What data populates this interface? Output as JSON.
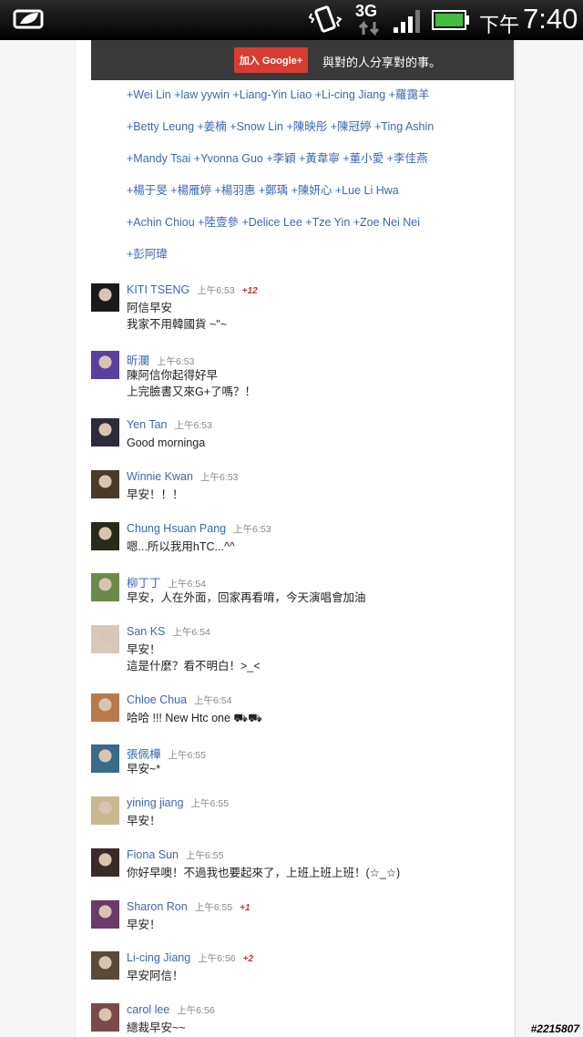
{
  "status_bar": {
    "network": "3G",
    "time_prefix": "下午",
    "time": "7:40"
  },
  "gplus_banner": {
    "button_label": "加入 Google+",
    "tagline": "與對的人分享對的事。"
  },
  "mentions": [
    "+Wei Lin +law yywin +Liang-Yin Liao +Li-cing Jiang +羅靄羊",
    "+Betty Leung +姜楠 +Snow Lin +陳映彤 +陳冠婷 +Ting Ashin",
    "+Mandy Tsai +Yvonna Guo +李穎 +黃韋寧 +董小愛 +李佳燕",
    "+楊于旻 +楊雁婷 +楊羽惠 +鄭瑀 +陳妍心 +Lue Li Hwa",
    "+Achin Chiou +陸壹參 +Delice Lee +Tze Yin +Zoe Nei Nei",
    "+彭阿瑋"
  ],
  "comments": [
    {
      "name": "KITI TSENG",
      "time": "上午6:53",
      "plus": "+12",
      "lines": [
        "阿信早安",
        "我家不用韓國貨 ~\"~"
      ],
      "avatar_color": "#1a1a1a"
    },
    {
      "name": "昕瀾",
      "time": "上午6:53",
      "plus": "",
      "lines": [
        "陳阿信你起得好早",
        "上完臉書又來G+了嗎？！"
      ],
      "avatar_color": "#5a3fa0"
    },
    {
      "name": "Yen Tan",
      "time": "上午6:53",
      "plus": "",
      "lines": [
        "Good morninga"
      ],
      "avatar_color": "#2b2b3a"
    },
    {
      "name": "Winnie Kwan",
      "time": "上午6:53",
      "plus": "",
      "lines": [
        "早安！！！"
      ],
      "avatar_color": "#4a3a2a"
    },
    {
      "name": "Chung Hsuan Pang",
      "time": "上午6:53",
      "plus": "",
      "lines": [
        "嗯...所以我用hTC...^^"
      ],
      "avatar_color": "#2a2a1a"
    },
    {
      "name": "柳丁丁",
      "time": "上午6:54",
      "plus": "",
      "lines": [
        "早安，人在外面，回家再看唷，今天演唱會加油"
      ],
      "avatar_color": "#6a8a4a"
    },
    {
      "name": "San KS",
      "time": "上午6:54",
      "plus": "",
      "lines": [
        "早安！",
        "這是什麼？看不明白！>_<"
      ],
      "avatar_color": "#d8c8b8"
    },
    {
      "name": "Chloe Chua",
      "time": "上午6:54",
      "plus": "",
      "lines": [
        "哈哈 !!! New Htc one ⛟⛟"
      ],
      "avatar_color": "#b87a4a"
    },
    {
      "name": "張佩樺",
      "time": "上午6:55",
      "plus": "",
      "lines": [
        "早安~*"
      ],
      "avatar_color": "#3a6a8a"
    },
    {
      "name": "yining jiang",
      "time": "上午6:55",
      "plus": "",
      "lines": [
        "早安！"
      ],
      "avatar_color": "#c8b890"
    },
    {
      "name": "Fiona Sun",
      "time": "上午6:55",
      "plus": "",
      "lines": [
        "你好早噢！不過我也要起來了，上班上班上班！(☆_☆)"
      ],
      "avatar_color": "#3a2a2a"
    },
    {
      "name": "Sharon Ron",
      "time": "上午6:55",
      "plus": "+1",
      "lines": [
        "早安！"
      ],
      "avatar_color": "#6a3a6a"
    },
    {
      "name": "Li-cing Jiang",
      "time": "上午6:56",
      "plus": "+2",
      "lines": [
        "早安阿信！"
      ],
      "avatar_color": "#5a4a3a"
    },
    {
      "name": "carol lee",
      "time": "上午6:56",
      "plus": "",
      "lines": [
        "總裁早安~~"
      ],
      "avatar_color": "#7a4a4a"
    }
  ],
  "watermark": "#2215807"
}
